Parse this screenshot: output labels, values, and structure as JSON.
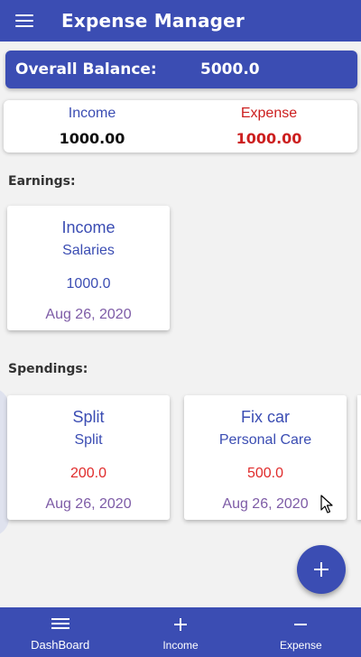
{
  "colors": {
    "primary": "#3b4db3",
    "income_text": "#3b4db3",
    "expense_text": "#cc1f1f",
    "amount_blue": "#3b4db3",
    "amount_red": "#e02b2b",
    "date_purple": "#7d5ba6"
  },
  "app_bar": {
    "menu_icon": "hamburger-menu-icon",
    "title": "Expense Manager"
  },
  "balance": {
    "label": "Overall Balance:",
    "value": "5000.0"
  },
  "summary": {
    "income_label": "Income",
    "income_value": "1000.00",
    "expense_label": "Expense",
    "expense_value": "1000.00"
  },
  "earnings": {
    "title": "Earnings:",
    "items": [
      {
        "title": "Income",
        "category": "Salaries",
        "amount": "1000.0",
        "date": "Aug 26, 2020"
      }
    ]
  },
  "spendings": {
    "title": "Spendings:",
    "items": [
      {
        "title": "Split",
        "category": "Split",
        "amount": "200.0",
        "date": "Aug 26, 2020"
      },
      {
        "title": "Fix car",
        "category": "Personal Care",
        "amount": "500.0",
        "date": "Aug 26, 2020"
      }
    ]
  },
  "fab": {
    "icon": "plus-icon"
  },
  "bottom_nav": {
    "items": [
      {
        "icon": "menu-icon",
        "label": "DashBoard"
      },
      {
        "icon": "plus-icon",
        "label": "Income"
      },
      {
        "icon": "minus-icon",
        "label": "Expense"
      }
    ]
  }
}
